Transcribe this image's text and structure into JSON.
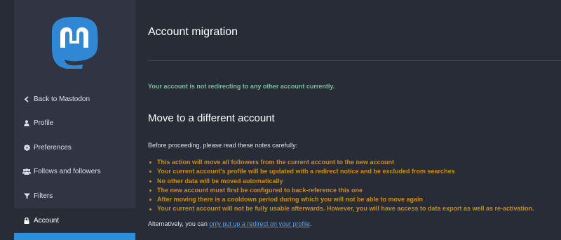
{
  "sidebar": {
    "items": [
      {
        "label": "Back to Mastodon",
        "icon": "chevron-left-icon"
      },
      {
        "label": "Profile",
        "icon": "user-icon"
      },
      {
        "label": "Preferences",
        "icon": "gear-icon"
      },
      {
        "label": "Follows and followers",
        "icon": "users-icon"
      },
      {
        "label": "Filters",
        "icon": "filter-icon"
      },
      {
        "label": "Account",
        "icon": "lock-icon",
        "active": true
      }
    ]
  },
  "main": {
    "title": "Account migration",
    "status": "Your account is not redirecting to any other account currently.",
    "section_title": "Move to a different account",
    "intro": "Before proceeding, please read these notes carefully:",
    "notes": [
      "This action will move all followers from the current account to the new account",
      "Your current account's profile will be updated with a redirect notice and be excluded from searches",
      "No other data will be moved automatically",
      "The new account must first be configured to back-reference this one",
      "After moving there is a cooldown period during which you will not be able to move again",
      "Your current account will not be fully usable afterwards. However, you will have access to data export as well as re-activation."
    ],
    "alt_prefix": "Alternatively, you can ",
    "alt_link": "only put up a redirect on your profile",
    "alt_suffix": "."
  },
  "colors": {
    "background": "#282c37",
    "sidebar": "#313543",
    "accent": "#2b90d9",
    "success": "#79bd9a",
    "warning": "#ca8f04",
    "link": "#4ea2f1"
  }
}
